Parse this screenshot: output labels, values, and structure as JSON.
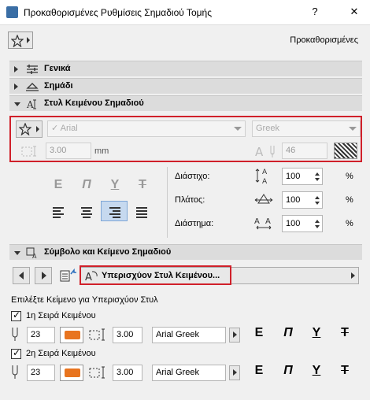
{
  "window": {
    "title": "Προκαθορισμένες Ρυθμίσεις Σημαδιού Τομής",
    "help": "?",
    "close": "✕"
  },
  "header": {
    "defaults_label": "Προκαθορισμένες"
  },
  "sections": {
    "general": "Γενικά",
    "marker": "Σημάδι",
    "text_style": "Στυλ Κειμένου Σημαδιού",
    "symbol_text": "Σύμβολο και Κείμενο Σημαδιού"
  },
  "text_style": {
    "font": "Arial",
    "script": "Greek",
    "size": "3.00",
    "size_unit": "mm",
    "pen": "46",
    "styles": [
      "E",
      "Π",
      "Y",
      "T"
    ],
    "spacing_label": "Διάστιχο:",
    "spacing_value": "100",
    "width_label": "Πλάτος:",
    "width_value": "100",
    "gap_label": "Διάστημα:",
    "gap_value": "100",
    "percent": "%"
  },
  "symbol": {
    "override_label": "Υπερισχύον Στυλ Κειμένου...",
    "choose_label": "Επιλέξτε Κείμενο για Υπερισχύον Στυλ",
    "rows": [
      {
        "label": "1η Σειρά Κειμένου",
        "pen": "23",
        "size": "3.00",
        "font": "Arial Greek",
        "checked": true
      },
      {
        "label": "2η Σειρά Κειμένου",
        "pen": "23",
        "size": "3.00",
        "font": "Arial Greek",
        "checked": true
      }
    ],
    "styles": [
      "E",
      "Π",
      "Y",
      "T"
    ]
  },
  "colors": {
    "accent": "#d0202a",
    "pen_swatch": "#e8741f",
    "selected": "#c6d9ef"
  }
}
